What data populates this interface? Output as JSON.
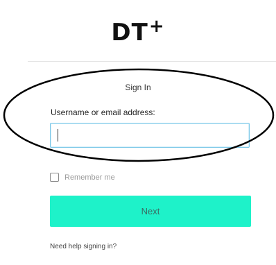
{
  "logo": {
    "text": "DT",
    "plus": "+"
  },
  "form": {
    "title": "Sign In",
    "username_label": "Username or email address:",
    "username_value": "",
    "remember_label": "Remember me",
    "remember_checked": false,
    "next_label": "Next",
    "help_link": "Need help signing in?"
  },
  "colors": {
    "accent": "#1ef2c9",
    "input_focus_border": "#7cc8e8",
    "annotation": "#000000"
  }
}
